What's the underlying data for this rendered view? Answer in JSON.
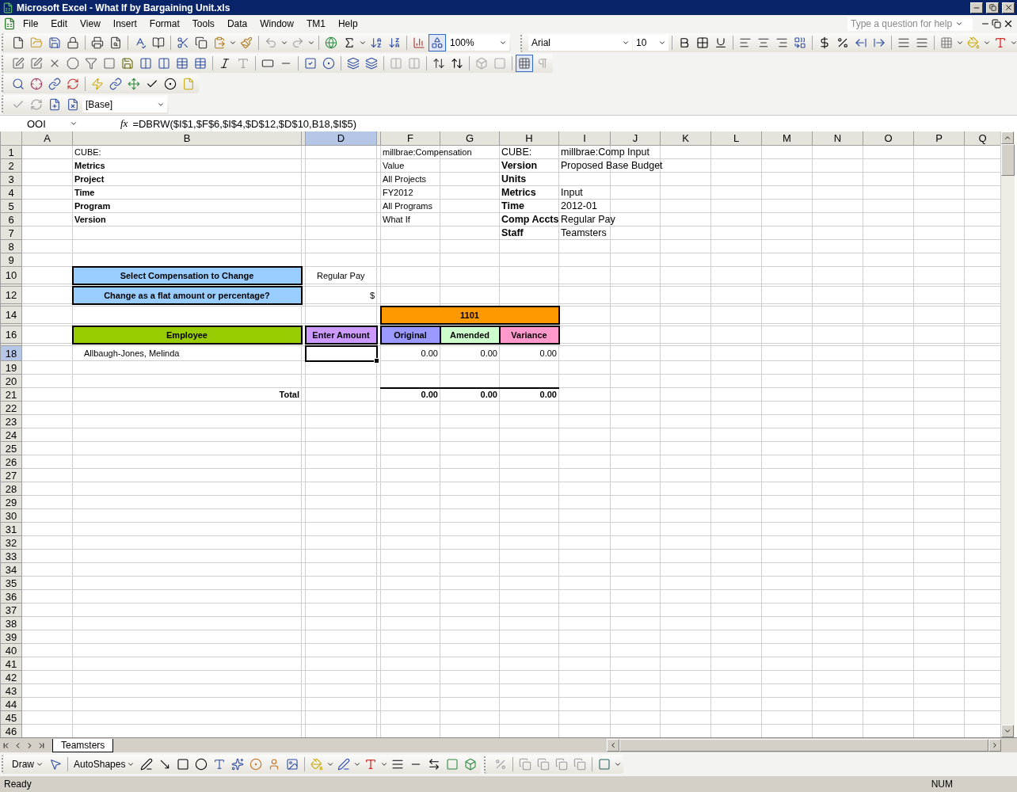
{
  "window": {
    "title": "Microsoft Excel - What If by Bargaining Unit.xls"
  },
  "menu": {
    "items": [
      "File",
      "Edit",
      "View",
      "Insert",
      "Format",
      "Tools",
      "Data",
      "Window",
      "TM1",
      "Help"
    ],
    "help_placeholder": "Type a question for help"
  },
  "standard_toolbar": {
    "zoom": "100%",
    "drawing_pressed": true
  },
  "formatting_toolbar": {
    "font": "Arial",
    "size": "10"
  },
  "forms_toolbar": {
    "gridlines_pressed": true
  },
  "tm1_toolbar": {
    "server": "[Base]"
  },
  "formula_bar": {
    "name_box": "OOI",
    "fx_label": "fx",
    "formula": "=DBRW($I$1,$F$6,$I$4,$D$12,$D$10,B18,$I$5)"
  },
  "sheet": {
    "columns": [
      {
        "letter": "A",
        "selected": false
      },
      {
        "letter": "B",
        "selected": false
      },
      {
        "selected": false
      },
      {
        "letter": "D",
        "selected": true
      },
      {
        "selected": false
      },
      {
        "letter": "F",
        "selected": false
      },
      {
        "letter": "G",
        "selected": false
      },
      {
        "letter": "H",
        "selected": false
      },
      {
        "letter": "I",
        "selected": false
      },
      {
        "letter": "J",
        "selected": false
      },
      {
        "letter": "K",
        "selected": false
      },
      {
        "letter": "L",
        "selected": false
      },
      {
        "letter": "M",
        "selected": false
      },
      {
        "letter": "N",
        "selected": false
      },
      {
        "letter": "O",
        "selected": false
      },
      {
        "letter": "P",
        "selected": false
      },
      {
        "letter": "Q",
        "selected": false
      }
    ],
    "rows": [
      {
        "number": "1",
        "selected": false,
        "cells": {
          "B": {
            "kind": "small",
            "text": "CUBE:"
          },
          "F": {
            "kind": "small",
            "text": "millbrae:Compensation"
          },
          "H": {
            "kind": "normal",
            "text": "CUBE:"
          },
          "I": {
            "kind": "normal",
            "text": "millbrae:Comp Input"
          }
        }
      },
      {
        "number": "2",
        "selected": false,
        "cells": {
          "B": {
            "kind": "small_bold",
            "text": "Metrics"
          },
          "F": {
            "kind": "small",
            "text": "Value"
          },
          "H": {
            "kind": "normal_bold",
            "text": "Version"
          },
          "I": {
            "kind": "normal",
            "text": "Proposed Base Budget"
          }
        }
      },
      {
        "number": "3",
        "selected": false,
        "cells": {
          "B": {
            "kind": "small_bold",
            "text": "Project"
          },
          "F": {
            "kind": "small",
            "text": "All Projects"
          },
          "H": {
            "kind": "normal_bold",
            "text": "Units"
          }
        }
      },
      {
        "number": "4",
        "selected": false,
        "cells": {
          "B": {
            "kind": "small_bold",
            "text": "Time"
          },
          "F": {
            "kind": "small",
            "text": "FY2012"
          },
          "H": {
            "kind": "normal_bold",
            "text": "Metrics"
          },
          "I": {
            "kind": "normal",
            "text": "Input"
          }
        }
      },
      {
        "number": "5",
        "selected": false,
        "cells": {
          "B": {
            "kind": "small_bold",
            "text": "Program"
          },
          "F": {
            "kind": "small",
            "text": "All Programs"
          },
          "H": {
            "kind": "normal_bold",
            "text": "Time"
          },
          "I": {
            "kind": "normal",
            "text": "2012-01"
          }
        }
      },
      {
        "number": "6",
        "selected": false,
        "cells": {
          "B": {
            "kind": "small_bold",
            "text": "Version"
          },
          "F": {
            "kind": "small",
            "text": "What If"
          },
          "H": {
            "kind": "normal_bold",
            "text": "Comp Accts"
          },
          "I": {
            "kind": "normal",
            "text": "Regular Pay"
          }
        }
      },
      {
        "number": "7",
        "selected": false,
        "cells": {
          "H": {
            "kind": "normal_bold",
            "text": "Staff"
          },
          "I": {
            "kind": "normal",
            "text": "Teamsters"
          }
        }
      },
      {
        "number": "8",
        "selected": false
      },
      {
        "number": "9",
        "selected": false
      },
      {
        "number": "10",
        "selected": false,
        "cells": {
          "B": {
            "kind": "banner",
            "color": "#99ccff",
            "text": "Select Compensation to Change"
          },
          "D": {
            "kind": "small_indent",
            "text": "Regular Pay"
          }
        }
      },
      {
        "kind": "spacer"
      },
      {
        "number": "12",
        "selected": false,
        "cells": {
          "B": {
            "kind": "banner",
            "color": "#99ccff",
            "text": "Change as a flat amount or percentage?"
          },
          "D": {
            "kind": "number",
            "text": "$"
          }
        }
      },
      {
        "kind": "spacer"
      },
      {
        "number": "14",
        "selected": false,
        "cells": {
          "F": {
            "kind": "banner_wide",
            "color": "#ff9900",
            "text": "1101"
          }
        }
      },
      {
        "kind": "spacer"
      },
      {
        "number": "16",
        "selected": false,
        "cells": {
          "B": {
            "kind": "banner",
            "color": "#99cc00",
            "text": "Employee"
          },
          "D": {
            "kind": "banner",
            "color": "#cc99ff",
            "text": "Enter Amount"
          },
          "F": {
            "kind": "banner",
            "color": "#9999ff",
            "text": "Original"
          },
          "G": {
            "kind": "banner",
            "color": "#ccffcc",
            "text": "Amended"
          },
          "H": {
            "kind": "banner",
            "color": "#ff99cc",
            "text": "Variance"
          }
        }
      },
      {
        "kind": "spacer"
      },
      {
        "number": "18",
        "selected": true,
        "cells": {
          "B": {
            "kind": "small_indent",
            "text": "Allbaugh-Jones, Melinda"
          },
          "D": {
            "kind": "input",
            "selected": true
          },
          "F": {
            "kind": "number",
            "text": "0.00"
          },
          "G": {
            "kind": "number",
            "text": "0.00"
          },
          "H": {
            "kind": "number",
            "text": "0.00"
          }
        }
      },
      {
        "number": "19",
        "selected": false
      },
      {
        "number": "20",
        "selected": false
      },
      {
        "number": "21",
        "selected": false,
        "cells": {
          "B": {
            "kind": "total_label",
            "text": "Total"
          },
          "F": {
            "kind": "total",
            "text": "0.00"
          },
          "G": {
            "kind": "total",
            "text": "0.00"
          },
          "H": {
            "kind": "total",
            "text": "0.00"
          }
        }
      },
      {
        "number": "22",
        "selected": false
      },
      {
        "number": "23",
        "selected": false
      },
      {
        "number": "24",
        "selected": false
      },
      {
        "number": "25",
        "selected": false
      },
      {
        "number": "26",
        "selected": false
      },
      {
        "number": "27",
        "selected": false
      },
      {
        "number": "28",
        "selected": false
      },
      {
        "number": "29",
        "selected": false
      },
      {
        "number": "30",
        "selected": false
      },
      {
        "number": "31",
        "selected": false
      },
      {
        "number": "32",
        "selected": false
      },
      {
        "number": "33",
        "selected": false
      },
      {
        "number": "34",
        "selected": false
      },
      {
        "number": "35",
        "selected": false
      },
      {
        "number": "36",
        "selected": false
      },
      {
        "number": "37",
        "selected": false
      },
      {
        "number": "38",
        "selected": false
      },
      {
        "number": "39",
        "selected": false
      },
      {
        "number": "40",
        "selected": false
      },
      {
        "number": "41",
        "selected": false
      },
      {
        "number": "42",
        "selected": false
      },
      {
        "number": "43",
        "selected": false
      },
      {
        "number": "44",
        "selected": false
      },
      {
        "number": "45",
        "selected": false
      },
      {
        "number": "46",
        "selected": false
      }
    ]
  },
  "sheet_tabs": [
    {
      "label": "Teamsters",
      "selected": true
    }
  ],
  "drawing_toolbar": {
    "draw_label": "Draw",
    "autoshapes_label": "AutoShapes"
  },
  "status_bar": {
    "status": "Ready",
    "indicator": "NUM"
  }
}
